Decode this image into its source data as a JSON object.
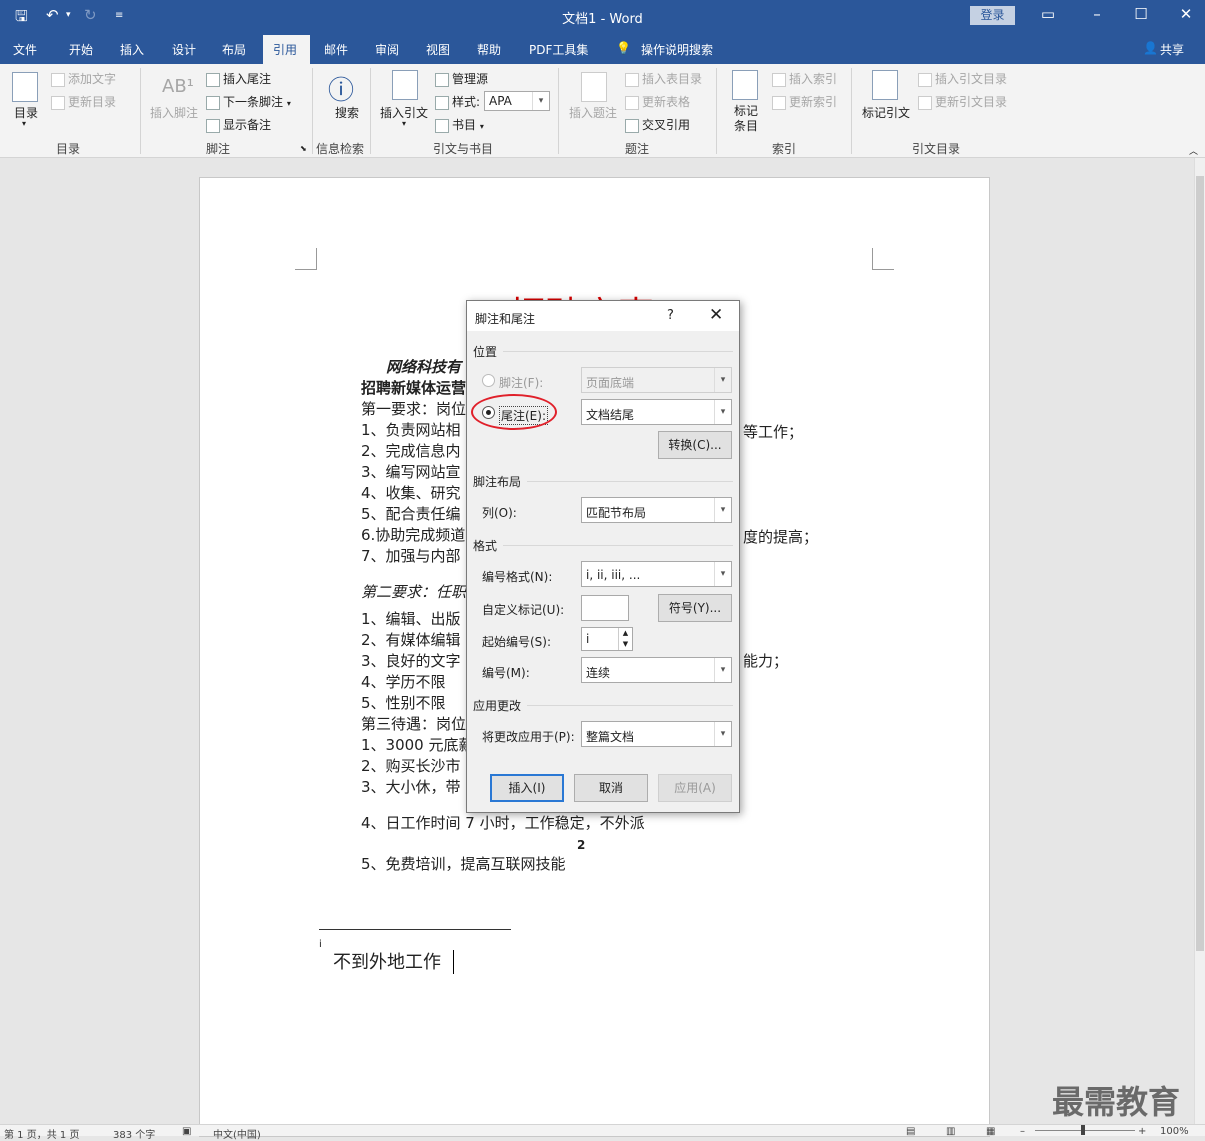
{
  "titlebar": {
    "doc_title": "文档1  -  Word",
    "login": "登录"
  },
  "tabs": [
    "文件",
    "开始",
    "插入",
    "设计",
    "布局",
    "引用",
    "邮件",
    "审阅",
    "视图",
    "帮助",
    "PDF工具集",
    "操作说明搜索"
  ],
  "share": "共享",
  "ribbon": {
    "toc": {
      "btn": "目录",
      "add_text": "添加文字",
      "update_toc": "更新目录",
      "group": "目录"
    },
    "footnotes": {
      "insert_footnote": "插入脚注",
      "insert_endnote": "插入尾注",
      "next_footnote": "下一条脚注",
      "show_notes": "显示备注",
      "group": "脚注"
    },
    "research": {
      "search": "搜索",
      "group": "信息检索"
    },
    "citations": {
      "insert_citation": "插入引文",
      "manage_sources": "管理源",
      "style_label": "样式:",
      "style_value": "APA",
      "bibliography": "书目",
      "group": "引文与书目"
    },
    "captions": {
      "insert_caption": "插入题注",
      "insert_table_of_figures": "插入表目录",
      "update_table": "更新表格",
      "cross_reference": "交叉引用",
      "group": "题注"
    },
    "index": {
      "mark_entry": "标记条目",
      "insert_index": "插入索引",
      "update_index": "更新索引",
      "group": "索引"
    },
    "toa": {
      "mark_citation": "标记引文",
      "insert_toa": "插入引文目录",
      "update_toa": "更新引文目录",
      "group": "引文目录"
    }
  },
  "document": {
    "title": "招聘启事",
    "lines": [
      "网络科技有",
      "招聘新媒体运营",
      "第一要求：岗位",
      "1、负责网站相",
      "2、完成信息内",
      "3、编写网站宣",
      "4、收集、研究",
      "5、配合责任编",
      "6.协助完成频道",
      "7、加强与内部",
      "第二要求：任职",
      "1、编辑、出版",
      "2、有媒体编辑",
      "3、良好的文字",
      "4、学历不限",
      "5、性别不限",
      "第三待遇：岗位",
      "1、3000 元底薪",
      "2、购买长沙市",
      "3、大小休，带",
      "4、日工作时间 7 小时，工作稳定，不外派",
      "5、免费培训，提高互联网技能"
    ],
    "right_fragments": {
      "line1": "等工作；",
      "line6": "度的提高；",
      "line_skill": "能力；"
    },
    "endnote_ref": "2",
    "footnote_mark": "i",
    "footnote_text": "不到外地工作"
  },
  "dialog": {
    "title": "脚注和尾注",
    "help": "?",
    "section_position": "位置",
    "footnote_label": "脚注(F):",
    "footnote_value": "页面底端",
    "endnote_label": "尾注(E):",
    "endnote_value": "文档结尾",
    "convert": "转换(C)...",
    "section_layout": "脚注布局",
    "columns_label": "列(O):",
    "columns_value": "匹配节布局",
    "section_format": "格式",
    "numfmt_label": "编号格式(N):",
    "numfmt_value": "i, ii, iii, ...",
    "custom_label": "自定义标记(U):",
    "symbol": "符号(Y)...",
    "start_label": "起始编号(S):",
    "start_value": "i",
    "numbering_label": "编号(M):",
    "numbering_value": "连续",
    "section_apply": "应用更改",
    "apply_to_label": "将更改应用于(P):",
    "apply_to_value": "整篇文档",
    "insert": "插入(I)",
    "cancel": "取消",
    "apply": "应用(A)"
  },
  "status": {
    "page": "第 1 页，共 1 页",
    "words": "383 个字",
    "lang": "中文(中国)",
    "zoom": "100%"
  },
  "watermark": "最需教育"
}
